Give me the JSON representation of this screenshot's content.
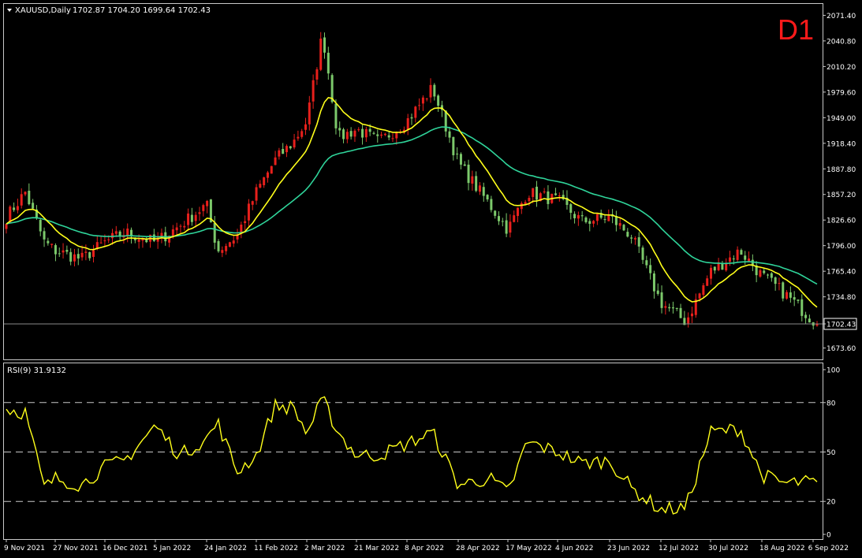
{
  "header": {
    "symbol_label": "XAUUSD,Daily",
    "ohlc": "1702.87 1704.20 1699.64 1702.43",
    "timeframe_badge": "D1"
  },
  "colors": {
    "background": "#000000",
    "bull_candle": "#e8201c",
    "bear_candle": "#7cc96b",
    "fast_ma": "#ffff1a",
    "slow_ma": "#2fd49a",
    "rsi_line": "#ffff1a",
    "badge": "#ff1a1a",
    "frame": "#c8c8c8"
  },
  "chart_data": [
    {
      "type": "candlestick",
      "symbol": "XAUUSD",
      "period": "Daily",
      "ylim": [
        1660,
        2085
      ],
      "price_ticks": [
        2071.4,
        2040.8,
        2010.2,
        1979.6,
        1949.0,
        1918.4,
        1887.8,
        1857.2,
        1826.6,
        1796.0,
        1765.4,
        1734.8,
        1702.43,
        1673.6
      ],
      "price_tick_labels": [
        "2071.40",
        "2040.80",
        "2010.20",
        "1979.60",
        "1949.00",
        "1918.40",
        "1887.80",
        "1857.20",
        "1826.60",
        "1796.00",
        "1765.40",
        "1734.80",
        "1702.43",
        "1673.60"
      ],
      "current_price": 1702.43,
      "current_price_label": "1702.43",
      "dates": [
        "9 Nov 2021",
        "27 Nov 2021",
        "16 Dec 2021",
        "5 Jan 2022",
        "24 Jan 2022",
        "11 Feb 2022",
        "2 Mar 2022",
        "21 Mar 2022",
        "8 Apr 2022",
        "28 Apr 2022",
        "17 May 2022",
        "4 Jun 2022",
        "23 Jun 2022",
        "12 Jul 2022",
        "30 Jul 2022",
        "18 Aug 2022",
        "6 Sep 2022"
      ],
      "close_path": [
        {
          "date": "9 Nov 2021",
          "close": 1830
        },
        {
          "date": "16 Nov 2021",
          "close": 1860
        },
        {
          "date": "23 Nov 2021",
          "close": 1800
        },
        {
          "date": "27 Nov 2021",
          "close": 1790
        },
        {
          "date": "7 Dec 2021",
          "close": 1780
        },
        {
          "date": "16 Dec 2021",
          "close": 1800
        },
        {
          "date": "24 Dec 2021",
          "close": 1812
        },
        {
          "date": "5 Jan 2022",
          "close": 1800
        },
        {
          "date": "14 Jan 2022",
          "close": 1820
        },
        {
          "date": "24 Jan 2022",
          "close": 1845
        },
        {
          "date": "28 Jan 2022",
          "close": 1790
        },
        {
          "date": "4 Feb 2022",
          "close": 1808
        },
        {
          "date": "11 Feb 2022",
          "close": 1860
        },
        {
          "date": "18 Feb 2022",
          "close": 1898
        },
        {
          "date": "25 Feb 2022",
          "close": 1920
        },
        {
          "date": "2 Mar 2022",
          "close": 1945
        },
        {
          "date": "8 Mar 2022",
          "close": 2050
        },
        {
          "date": "14 Mar 2022",
          "close": 1925
        },
        {
          "date": "21 Mar 2022",
          "close": 1935
        },
        {
          "date": "29 Mar 2022",
          "close": 1920
        },
        {
          "date": "8 Apr 2022",
          "close": 1945
        },
        {
          "date": "18 Apr 2022",
          "close": 1985
        },
        {
          "date": "28 Apr 2022",
          "close": 1895
        },
        {
          "date": "10 May 2022",
          "close": 1845
        },
        {
          "date": "17 May 2022",
          "close": 1815
        },
        {
          "date": "24 May 2022",
          "close": 1860
        },
        {
          "date": "4 Jun 2022",
          "close": 1850
        },
        {
          "date": "13 Jun 2022",
          "close": 1825
        },
        {
          "date": "23 Jun 2022",
          "close": 1830
        },
        {
          "date": "1 Jul 2022",
          "close": 1808
        },
        {
          "date": "12 Jul 2022",
          "close": 1728
        },
        {
          "date": "21 Jul 2022",
          "close": 1705
        },
        {
          "date": "30 Jul 2022",
          "close": 1765
        },
        {
          "date": "10 Aug 2022",
          "close": 1790
        },
        {
          "date": "18 Aug 2022",
          "close": 1760
        },
        {
          "date": "26 Aug 2022",
          "close": 1740
        },
        {
          "date": "6 Sep 2022",
          "close": 1702.43
        }
      ],
      "series": [
        {
          "role": "fast moving average",
          "color": "#ffff1a"
        },
        {
          "role": "slow moving average",
          "color": "#2fd49a"
        }
      ]
    },
    {
      "type": "line",
      "indicator_label": "RSI(9) 31.9132",
      "ylim": [
        0,
        100
      ],
      "y_ticks": [
        100,
        80,
        50,
        20,
        0
      ],
      "y_tick_labels": [
        "100",
        "80",
        "50",
        "20",
        "0"
      ],
      "levels": [
        80,
        50,
        20
      ],
      "x": [
        "9 Nov 2021",
        "16 Nov 2021",
        "23 Nov 2021",
        "27 Nov 2021",
        "7 Dec 2021",
        "16 Dec 2021",
        "24 Dec 2021",
        "5 Jan 2022",
        "14 Jan 2022",
        "24 Jan 2022",
        "28 Jan 2022",
        "4 Feb 2022",
        "11 Feb 2022",
        "18 Feb 2022",
        "25 Feb 2022",
        "2 Mar 2022",
        "8 Mar 2022",
        "14 Mar 2022",
        "21 Mar 2022",
        "29 Mar 2022",
        "8 Apr 2022",
        "18 Apr 2022",
        "28 Apr 2022",
        "10 May 2022",
        "17 May 2022",
        "24 May 2022",
        "4 Jun 2022",
        "13 Jun 2022",
        "23 Jun 2022",
        "1 Jul 2022",
        "12 Jul 2022",
        "21 Jul 2022",
        "30 Jul 2022",
        "10 Aug 2022",
        "18 Aug 2022",
        "26 Aug 2022",
        "6 Sep 2022"
      ],
      "values": [
        76,
        74,
        28,
        34,
        30,
        41,
        45,
        66,
        48,
        58,
        68,
        38,
        48,
        78,
        77,
        61,
        82,
        62,
        48,
        48,
        55,
        62,
        30,
        34,
        25,
        56,
        50,
        43,
        45,
        28,
        15,
        16,
        62,
        64,
        36,
        31,
        31.9
      ]
    }
  ]
}
